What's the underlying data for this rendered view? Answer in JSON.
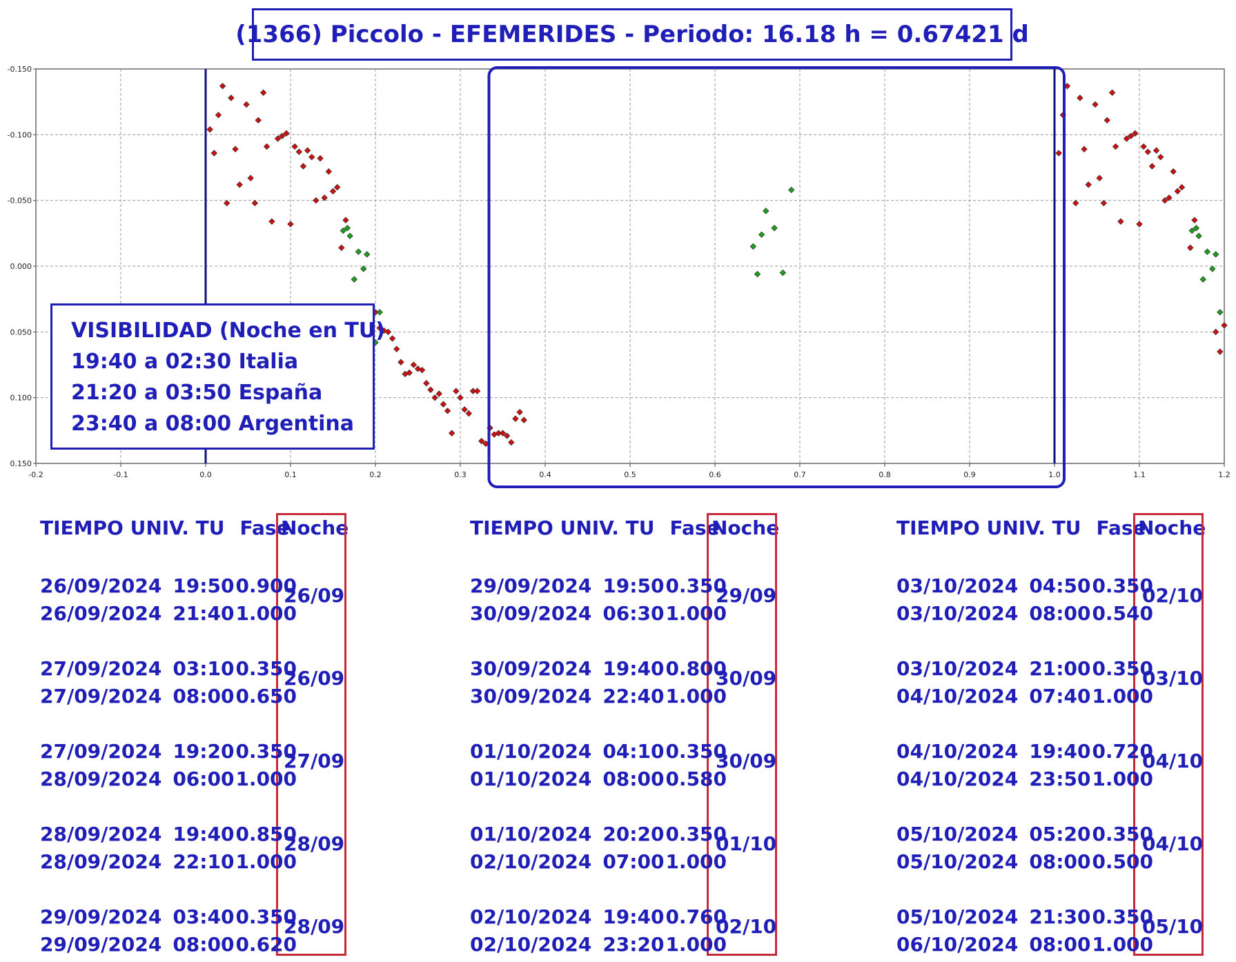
{
  "title": "(1366) Piccolo - EFEMERIDES - Periodo: 16.18 h = 0.67421 d",
  "visibility": {
    "heading": "VISIBILIDAD (Noche en TU)",
    "lines": [
      "19:40 a 02:30 Italia",
      "21:20 a 03:50 España",
      "23:40 a 08:00 Argentina"
    ]
  },
  "colors": {
    "accent": "#1f1fb8",
    "noche_border": "#c8293a",
    "red_points": "#cc1111",
    "green_points": "#1e9e1e"
  },
  "chart_data": {
    "type": "scatter",
    "xlim": [
      -0.2,
      1.2
    ],
    "ylim": [
      -0.15,
      0.15
    ],
    "y_inverted": true,
    "grid": true,
    "x_ticks": [
      -0.2,
      -0.1,
      0.0,
      0.1,
      0.2,
      0.3,
      0.4,
      0.5,
      0.6,
      0.7,
      0.8,
      0.9,
      1.0,
      1.1,
      1.2
    ],
    "x_tick_labels": [
      "-0.2",
      "-0.1",
      "0.0",
      "0.1",
      "0.2",
      "0.3",
      "0.4",
      "0.5",
      "0.6",
      "0.7",
      "0.8",
      "0.9",
      "1.0",
      "1.1",
      "1.2"
    ],
    "y_ticks": [
      -0.15,
      -0.1,
      -0.05,
      0.0,
      0.05,
      0.1,
      0.15
    ],
    "y_tick_labels": [
      "-0.150",
      "-0.100",
      "-0.050",
      "0.000",
      "0.050",
      "0.100",
      "0.150"
    ],
    "vertical_lines": [
      0.0,
      1.0
    ],
    "highlight_range": [
      0.35,
      1.0
    ],
    "series": [
      {
        "color": "#cc1111",
        "points": [
          [
            0.005,
            -0.104
          ],
          [
            0.01,
            -0.086
          ],
          [
            0.015,
            -0.115
          ],
          [
            0.02,
            -0.137
          ],
          [
            0.025,
            -0.048
          ],
          [
            0.03,
            -0.128
          ],
          [
            0.035,
            -0.089
          ],
          [
            0.04,
            -0.062
          ],
          [
            0.048,
            -0.123
          ],
          [
            0.053,
            -0.067
          ],
          [
            0.058,
            -0.048
          ],
          [
            0.062,
            -0.111
          ],
          [
            0.068,
            -0.132
          ],
          [
            0.072,
            -0.091
          ],
          [
            0.078,
            -0.034
          ],
          [
            0.085,
            -0.097
          ],
          [
            0.09,
            -0.099
          ],
          [
            0.095,
            -0.101
          ],
          [
            0.1,
            -0.032
          ],
          [
            0.105,
            -0.091
          ],
          [
            0.11,
            -0.087
          ],
          [
            0.115,
            -0.076
          ],
          [
            0.12,
            -0.088
          ],
          [
            0.125,
            -0.083
          ],
          [
            0.13,
            -0.05
          ],
          [
            0.135,
            -0.082
          ],
          [
            0.14,
            -0.052
          ],
          [
            0.145,
            -0.072
          ],
          [
            0.15,
            -0.057
          ],
          [
            0.155,
            -0.06
          ],
          [
            0.16,
            -0.014
          ],
          [
            0.165,
            -0.035
          ],
          [
            0.2,
            0.035
          ],
          [
            0.205,
            0.047
          ],
          [
            0.21,
            0.049
          ],
          [
            0.215,
            0.05
          ],
          [
            0.22,
            0.055
          ],
          [
            0.225,
            0.063
          ],
          [
            0.23,
            0.073
          ],
          [
            0.235,
            0.082
          ],
          [
            0.24,
            0.081
          ],
          [
            0.245,
            0.075
          ],
          [
            0.25,
            0.078
          ],
          [
            0.255,
            0.079
          ],
          [
            0.26,
            0.089
          ],
          [
            0.265,
            0.094
          ],
          [
            0.27,
            0.1
          ],
          [
            0.275,
            0.097
          ],
          [
            0.28,
            0.105
          ],
          [
            0.285,
            0.11
          ],
          [
            0.29,
            0.127
          ],
          [
            0.295,
            0.095
          ],
          [
            0.3,
            0.1
          ],
          [
            0.305,
            0.109
          ],
          [
            0.31,
            0.112
          ],
          [
            0.315,
            0.095
          ],
          [
            0.32,
            0.095
          ],
          [
            0.325,
            0.133
          ],
          [
            0.33,
            0.135
          ],
          [
            0.335,
            0.123
          ],
          [
            0.34,
            0.128
          ],
          [
            0.345,
            0.127
          ],
          [
            0.35,
            0.127
          ],
          [
            0.355,
            0.129
          ],
          [
            0.36,
            0.134
          ],
          [
            0.365,
            0.116
          ],
          [
            0.37,
            0.111
          ],
          [
            0.375,
            0.117
          ],
          [
            1.005,
            -0.086
          ],
          [
            1.01,
            -0.115
          ],
          [
            1.015,
            -0.137
          ],
          [
            1.025,
            -0.048
          ],
          [
            1.03,
            -0.128
          ],
          [
            1.035,
            -0.089
          ],
          [
            1.04,
            -0.062
          ],
          [
            1.048,
            -0.123
          ],
          [
            1.053,
            -0.067
          ],
          [
            1.058,
            -0.048
          ],
          [
            1.062,
            -0.111
          ],
          [
            1.068,
            -0.132
          ],
          [
            1.072,
            -0.091
          ],
          [
            1.078,
            -0.034
          ],
          [
            1.085,
            -0.097
          ],
          [
            1.09,
            -0.099
          ],
          [
            1.095,
            -0.101
          ],
          [
            1.1,
            -0.032
          ],
          [
            1.105,
            -0.091
          ],
          [
            1.11,
            -0.087
          ],
          [
            1.115,
            -0.076
          ],
          [
            1.12,
            -0.088
          ],
          [
            1.125,
            -0.083
          ],
          [
            1.13,
            -0.05
          ],
          [
            1.135,
            -0.052
          ],
          [
            1.14,
            -0.072
          ],
          [
            1.145,
            -0.057
          ],
          [
            1.15,
            -0.06
          ],
          [
            1.16,
            -0.014
          ],
          [
            1.165,
            -0.035
          ],
          [
            1.19,
            0.05
          ],
          [
            1.195,
            0.065
          ],
          [
            1.2,
            0.045
          ]
        ]
      },
      {
        "color": "#1e9e1e",
        "points": [
          [
            0.162,
            -0.027
          ],
          [
            0.167,
            -0.029
          ],
          [
            0.17,
            -0.023
          ],
          [
            0.175,
            0.01
          ],
          [
            0.18,
            -0.011
          ],
          [
            0.186,
            0.002
          ],
          [
            0.19,
            -0.009
          ],
          [
            0.195,
            0.032
          ],
          [
            0.2,
            0.058
          ],
          [
            0.205,
            0.035
          ],
          [
            0.645,
            -0.015
          ],
          [
            0.65,
            0.006
          ],
          [
            0.655,
            -0.024
          ],
          [
            0.66,
            -0.042
          ],
          [
            0.67,
            -0.029
          ],
          [
            0.68,
            0.005
          ],
          [
            0.69,
            -0.058
          ],
          [
            1.162,
            -0.027
          ],
          [
            1.167,
            -0.029
          ],
          [
            1.17,
            -0.023
          ],
          [
            1.175,
            0.01
          ],
          [
            1.18,
            -0.011
          ],
          [
            1.186,
            0.002
          ],
          [
            1.19,
            -0.009
          ],
          [
            1.195,
            0.035
          ]
        ]
      }
    ]
  },
  "tables": [
    {
      "header_time": "TIEMPO UNIV. TU",
      "header_phase": "Fase",
      "header_night": "Noche",
      "groups": [
        {
          "rows": [
            {
              "date": "26/09/2024",
              "time": "19:50",
              "phase": "0.900"
            },
            {
              "date": "26/09/2024",
              "time": "21:40",
              "phase": "1.000"
            }
          ],
          "night": "26/09"
        },
        {
          "rows": [
            {
              "date": "27/09/2024",
              "time": "03:10",
              "phase": "0.350"
            },
            {
              "date": "27/09/2024",
              "time": "08:00",
              "phase": "0.650"
            }
          ],
          "night": "26/09"
        },
        {
          "rows": [
            {
              "date": "27/09/2024",
              "time": "19:20",
              "phase": "0.350"
            },
            {
              "date": "28/09/2024",
              "time": "06:00",
              "phase": "1.000"
            }
          ],
          "night": "27/09"
        },
        {
          "rows": [
            {
              "date": "28/09/2024",
              "time": "19:40",
              "phase": "0.850"
            },
            {
              "date": "28/09/2024",
              "time": "22:10",
              "phase": "1.000"
            }
          ],
          "night": "28/09"
        },
        {
          "rows": [
            {
              "date": "29/09/2024",
              "time": "03:40",
              "phase": "0.350"
            },
            {
              "date": "29/09/2024",
              "time": "08:00",
              "phase": "0.620"
            }
          ],
          "night": "28/09"
        }
      ]
    },
    {
      "header_time": "TIEMPO UNIV. TU",
      "header_phase": "Fase",
      "header_night": "Noche",
      "groups": [
        {
          "rows": [
            {
              "date": "29/09/2024",
              "time": "19:50",
              "phase": "0.350"
            },
            {
              "date": "30/09/2024",
              "time": "06:30",
              "phase": "1.000"
            }
          ],
          "night": "29/09"
        },
        {
          "rows": [
            {
              "date": "30/09/2024",
              "time": "19:40",
              "phase": "0.800"
            },
            {
              "date": "30/09/2024",
              "time": "22:40",
              "phase": "1.000"
            }
          ],
          "night": "30/09"
        },
        {
          "rows": [
            {
              "date": "01/10/2024",
              "time": "04:10",
              "phase": "0.350"
            },
            {
              "date": "01/10/2024",
              "time": "08:00",
              "phase": "0.580"
            }
          ],
          "night": "30/09"
        },
        {
          "rows": [
            {
              "date": "01/10/2024",
              "time": "20:20",
              "phase": "0.350"
            },
            {
              "date": "02/10/2024",
              "time": "07:00",
              "phase": "1.000"
            }
          ],
          "night": "01/10"
        },
        {
          "rows": [
            {
              "date": "02/10/2024",
              "time": "19:40",
              "phase": "0.760"
            },
            {
              "date": "02/10/2024",
              "time": "23:20",
              "phase": "1.000"
            }
          ],
          "night": "02/10"
        }
      ]
    },
    {
      "header_time": "TIEMPO UNIV. TU",
      "header_phase": "Fase",
      "header_night": "Noche",
      "groups": [
        {
          "rows": [
            {
              "date": "03/10/2024",
              "time": "04:50",
              "phase": "0.350"
            },
            {
              "date": "03/10/2024",
              "time": "08:00",
              "phase": "0.540"
            }
          ],
          "night": "02/10"
        },
        {
          "rows": [
            {
              "date": "03/10/2024",
              "time": "21:00",
              "phase": "0.350"
            },
            {
              "date": "04/10/2024",
              "time": "07:40",
              "phase": "1.000"
            }
          ],
          "night": "03/10"
        },
        {
          "rows": [
            {
              "date": "04/10/2024",
              "time": "19:40",
              "phase": "0.720"
            },
            {
              "date": "04/10/2024",
              "time": "23:50",
              "phase": "1.000"
            }
          ],
          "night": "04/10"
        },
        {
          "rows": [
            {
              "date": "05/10/2024",
              "time": "05:20",
              "phase": "0.350"
            },
            {
              "date": "05/10/2024",
              "time": "08:00",
              "phase": "0.500"
            }
          ],
          "night": "04/10"
        },
        {
          "rows": [
            {
              "date": "05/10/2024",
              "time": "21:30",
              "phase": "0.350"
            },
            {
              "date": "06/10/2024",
              "time": "08:00",
              "phase": "1.000"
            }
          ],
          "night": "05/10"
        }
      ]
    }
  ]
}
